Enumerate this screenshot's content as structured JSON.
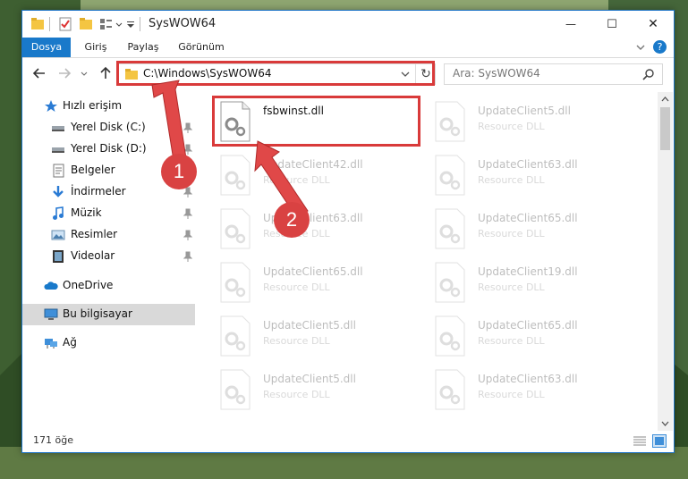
{
  "window": {
    "title": "SysWOW64",
    "minimize_label": "—",
    "maximize_label": "☐",
    "close_label": "✕"
  },
  "ribbon": {
    "tabs": [
      {
        "label": "Dosya",
        "active": true
      },
      {
        "label": "Giriş"
      },
      {
        "label": "Paylaş"
      },
      {
        "label": "Görünüm"
      }
    ],
    "help_label": "?"
  },
  "nav": {
    "address_path": "C:\\Windows\\SysWOW64",
    "search_placeholder": "Ara: SysWOW64",
    "refresh_label": "↻"
  },
  "sidebar": {
    "items": [
      {
        "label": "Hızlı erişim",
        "icon": "star-icon",
        "pinned": false
      },
      {
        "label": "Yerel Disk (C:)",
        "icon": "drive-icon",
        "pinned": true
      },
      {
        "label": "Yerel Disk (D:)",
        "icon": "drive-icon",
        "pinned": true
      },
      {
        "label": "Belgeler",
        "icon": "documents-icon",
        "pinned": true
      },
      {
        "label": "İndirmeler",
        "icon": "download-icon",
        "pinned": true
      },
      {
        "label": "Müzik",
        "icon": "music-icon",
        "pinned": true
      },
      {
        "label": "Resimler",
        "icon": "pictures-icon",
        "pinned": true
      },
      {
        "label": "Videolar",
        "icon": "videos-icon",
        "pinned": true
      },
      {
        "label": "OneDrive",
        "icon": "cloud-icon",
        "pinned": false
      },
      {
        "label": "Bu bilgisayar",
        "icon": "computer-icon",
        "pinned": false,
        "selected": true
      },
      {
        "label": "Ağ",
        "icon": "network-icon",
        "pinned": false
      }
    ]
  },
  "files": [
    {
      "name": "fsbwinst.dll",
      "type": "",
      "highlighted": true
    },
    {
      "name": "UpdateClient5.dll",
      "type": "Resource DLL"
    },
    {
      "name": "UpdateClient42.dll",
      "type": "Resource DLL"
    },
    {
      "name": "UpdateClient63.dll",
      "type": "Resource DLL"
    },
    {
      "name": "UpdateClient63.dll",
      "type": "Resource DLL"
    },
    {
      "name": "UpdateClient65.dll",
      "type": "Resource DLL"
    },
    {
      "name": "UpdateClient65.dll",
      "type": "Resource DLL"
    },
    {
      "name": "UpdateClient19.dll",
      "type": "Resource DLL"
    },
    {
      "name": "UpdateClient5.dll",
      "type": "Resource DLL"
    },
    {
      "name": "UpdateClient65.dll",
      "type": "Resource DLL"
    },
    {
      "name": "UpdateClient5.dll",
      "type": "Resource DLL"
    },
    {
      "name": "UpdateClient63.dll",
      "type": "Resource DLL"
    }
  ],
  "status": {
    "item_count": "171 öğe"
  },
  "annotations": [
    {
      "label": "1"
    },
    {
      "label": "2"
    }
  ],
  "colors": {
    "accent": "#1979ca",
    "highlight": "#d93a3a",
    "selected_bg": "#d9d9d9"
  }
}
